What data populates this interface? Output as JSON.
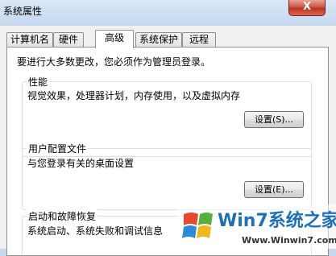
{
  "window": {
    "title": "系统属性",
    "close_symbol": "X"
  },
  "tabs": [
    {
      "label": "计算机名"
    },
    {
      "label": "硬件"
    },
    {
      "label": "高级",
      "selected": true
    },
    {
      "label": "系统保护"
    },
    {
      "label": "远程"
    }
  ],
  "notice": "要进行大多数更改，您必须作为管理员登录。",
  "groups": {
    "performance": {
      "title": "性能",
      "description": "视觉效果，处理器计划，内存使用，以及虚拟内存",
      "button": "设置(S)..."
    },
    "profiles": {
      "title": "用户配置文件",
      "description": "与您登录有关的桌面设置",
      "button": "设置(E)..."
    },
    "startup": {
      "title": "启动和故障恢复",
      "description": "系统启动、系统失败和调试信息"
    }
  },
  "watermark": {
    "brand": "Win7系统之家",
    "url": "Www.Winwin7.com"
  }
}
